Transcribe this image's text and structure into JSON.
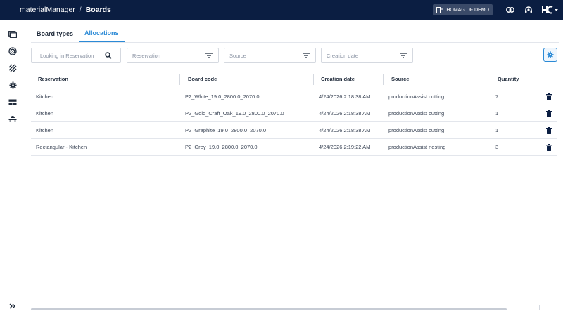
{
  "topbar": {
    "app_name": "materialManager",
    "separator": "/",
    "page": "Boards",
    "tenant_label": "HOMAG DF DEMO"
  },
  "tabs": [
    {
      "label": "Board types",
      "active": false
    },
    {
      "label": "Allocations",
      "active": true
    }
  ],
  "filters": {
    "search_placeholder": "Looking in Reservation",
    "reservation_placeholder": "Reservation",
    "source_placeholder": "Source",
    "creation_date_placeholder": "Creation date"
  },
  "table": {
    "columns": [
      "Reservation",
      "Board code",
      "Creation date",
      "Source",
      "Quantity"
    ],
    "rows": [
      {
        "reservation": "Kitchen",
        "board_code": "P2_White_19.0_2800.0_2070.0",
        "creation_date": "4/24/2026 2:18:38 AM",
        "source": "productionAssist cutting",
        "quantity": "7"
      },
      {
        "reservation": "Kitchen",
        "board_code": "P2_Gold_Craft_Oak_19.0_2800.0_2070.0",
        "creation_date": "4/24/2026 2:18:38 AM",
        "source": "productionAssist cutting",
        "quantity": "1"
      },
      {
        "reservation": "Kitchen",
        "board_code": "P2_Graphite_19.0_2800.0_2070.0",
        "creation_date": "4/24/2026 2:18:38 AM",
        "source": "productionAssist cutting",
        "quantity": "1"
      },
      {
        "reservation": "Rectangular - Kitchen",
        "board_code": "P2_Grey_19.0_2800.0_2070.0",
        "creation_date": "4/24/2026 2:19:22 AM",
        "source": "productionAssist nesting",
        "quantity": "3"
      }
    ]
  },
  "colors": {
    "topbar_bg": "#0b1e42",
    "accent": "#2b8ad6"
  },
  "icons": {
    "sidebar": [
      "boards-icon",
      "edgeband-icon",
      "hatch-icon",
      "gear-icon",
      "storage-icon",
      "machine-icon"
    ],
    "expand": "double-chevron-right-icon"
  }
}
